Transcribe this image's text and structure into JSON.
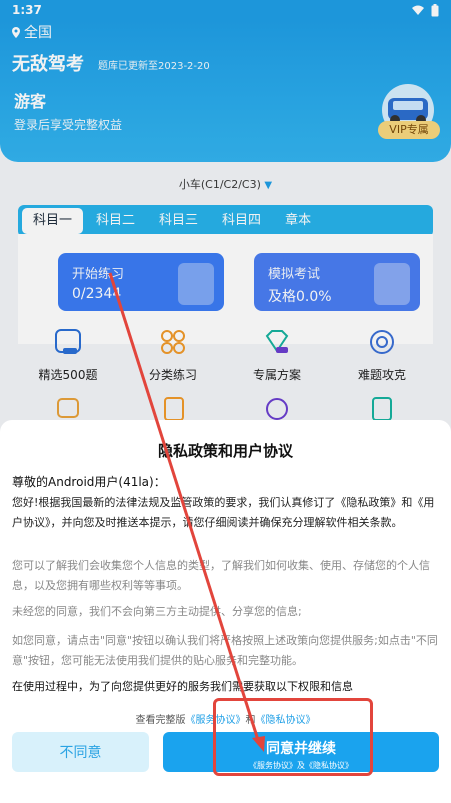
{
  "status": {
    "time": "1:37"
  },
  "header": {
    "region": "全国",
    "app_title": "无敌驾考",
    "db_update": "题库已更新至2023-2-20",
    "guest": "游客",
    "login_tip": "登录后享受完整权益",
    "vip_badge": "VIP专属"
  },
  "vehicle_selector": "小车(C1/C2/C3)",
  "tabs": [
    "科目一",
    "科目二",
    "科目三",
    "科目四",
    "章本"
  ],
  "cards": [
    {
      "title": "开始练习",
      "value": "0/2344"
    },
    {
      "title": "模拟考试",
      "value": "及格0.0%"
    }
  ],
  "features": [
    "精选500题",
    "分类练习",
    "专属方案",
    "难题攻克"
  ],
  "dialog": {
    "title": "隐私政策和用户协议",
    "greeting": "尊敬的Android用户(41la)：",
    "para1": "您好!根据我国最新的法律法规及监管政策的要求，我们认真修订了《隐私政策》和《用户协议》，并向您及时推送本提示，请您仔细阅读并确保充分理解软件相关条款。",
    "para2": "您可以了解我们会收集您个人信息的类型，了解我们如何收集、使用、存储您的个人信息，以及您拥有哪些权利等等事项。",
    "para3": "未经您的同意，我们不会向第三方主动提供、分享您的信息;",
    "para4": "如您同意，请点击\"同意\"按钮以确认我们将严格按照上述政策向您提供服务;如点击\"不同意\"按钮，您可能无法使用我们提供的贴心服务和完整功能。",
    "para5": "在使用过程中，为了向您提供更好的服务我们需要获取以下权限和信息",
    "links_prefix": "查看完整版",
    "link_service": "《服务协议》",
    "links_and": "和",
    "link_privacy": "《隐私协议》",
    "disagree_label": "不同意",
    "agree_label": "同意并继续",
    "agree_sub": "《服务协议》及《隐私协议》"
  }
}
